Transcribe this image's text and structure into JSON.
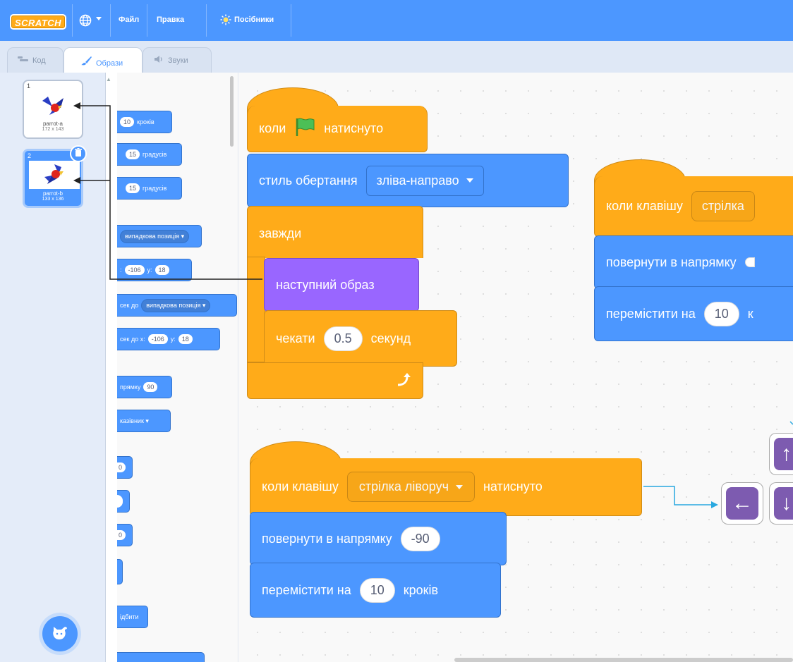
{
  "menubar": {
    "logo": "SCRATCH",
    "file": "Файл",
    "edit": "Правка",
    "tutorials": "Посібники"
  },
  "tabs": {
    "code": "Код",
    "costumes": "Образи",
    "sounds": "Звуки"
  },
  "costumes": [
    {
      "num": "1",
      "name": "parrot-a",
      "size": "172 x 143"
    },
    {
      "num": "2",
      "name": "parrot-b",
      "size": "133 x 136"
    }
  ],
  "palette": {
    "b1_val": "10",
    "b1_text": "кроків",
    "b2_val": "15",
    "b2_text": "градусів",
    "b3_val": "15",
    "b3_text": "градусів",
    "b4_text": "випадкова позиція",
    "b5_prefix": ":",
    "b5_x": "-106",
    "b5_ylabel": "y:",
    "b5_y": "18",
    "b6_text": "сек до",
    "b6_drop": "випадкова позиція",
    "b7_text": "сек до x:",
    "b7_x": "-106",
    "b7_ylabel": "y:",
    "b7_y": "18",
    "b8_text": "прямку",
    "b8_val": "90",
    "b9_text": "казівник",
    "b10_val": "0",
    "b12_val": "0",
    "b14_text": "ідбити"
  },
  "script1": {
    "hat_text1": "коли",
    "hat_text2": "натиснуто",
    "rotation_label": "стиль обертання",
    "rotation_value": "зліва-направо",
    "forever": "завжди",
    "next_costume": "наступний образ",
    "wait_label": "чекати",
    "wait_value": "0.5",
    "wait_unit": "секунд"
  },
  "script2": {
    "hat_label": "коли клавішу",
    "hat_key": "стрілка ліворуч",
    "hat_suffix": "натиснуто",
    "point_label": "повернути в напрямку",
    "point_value": "-90",
    "move_label": "перемістити на",
    "move_value": "10",
    "move_unit": "кроків"
  },
  "script3": {
    "hat_label": "коли клавішу",
    "hat_key": "стрілка",
    "point_label": "повернути в напрямку",
    "move_label": "перемістити на",
    "move_value": "10",
    "move_unit": "к"
  },
  "keys": {
    "left": "←",
    "up": "↑",
    "down": "↓"
  },
  "colors": {
    "menubar": "#4c97ff",
    "events": "#ffab19",
    "motion": "#4c97ff",
    "looks": "#9966ff",
    "control": "#ffab19"
  }
}
